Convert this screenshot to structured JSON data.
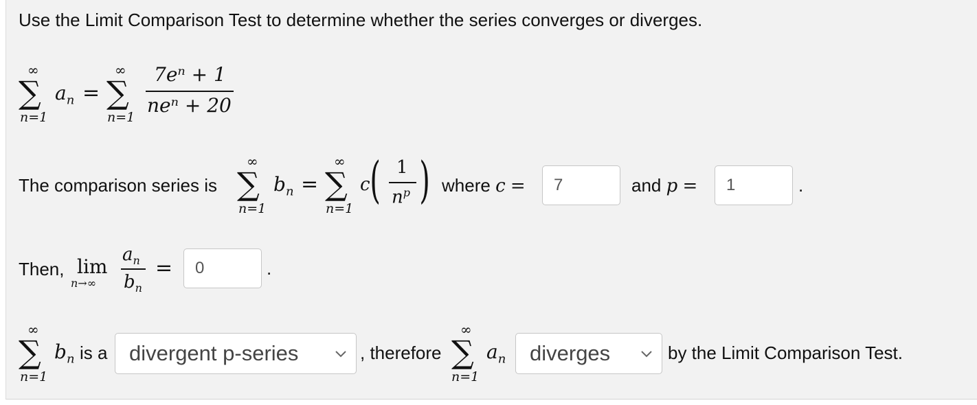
{
  "question": "Use the Limit Comparison Test to determine whether the series converges or diverges.",
  "sum_symbol": "∑",
  "infinity": "∞",
  "lower_index": "n=1",
  "an": "a",
  "bn": "b",
  "sub_n": "n",
  "equals": "=",
  "series_numerator": "7eⁿ + 1",
  "series_denominator": "neⁿ + 20",
  "comparison_prefix": "The comparison series is",
  "c_symbol": "c",
  "one": "1",
  "np_base": "n",
  "np_exp": "p",
  "where_text": "where",
  "c_value": "7",
  "and_text": "and",
  "p_value": "1",
  "period": ".",
  "then_text": "Then,",
  "lim_text": "lim",
  "lim_sub": "n→∞",
  "limit_value": "0",
  "is_a_text": "is a",
  "select_series_type": "divergent p-series",
  "therefore_text": ", therefore",
  "select_result": "diverges",
  "conclusion_text": "by the Limit Comparison Test."
}
